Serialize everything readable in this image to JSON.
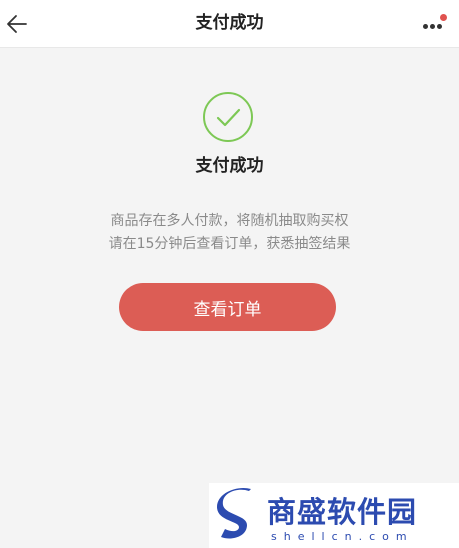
{
  "header": {
    "title": "支付成功",
    "back_icon": "arrow-left-icon",
    "more_icon": "more-dots-icon",
    "badge_color": "#e0524f"
  },
  "status": {
    "icon": "check-circle-icon",
    "icon_color": "#7dc855",
    "title": "支付成功"
  },
  "message": {
    "line1": "商品存在多人付款，将随机抽取购买权",
    "line2": "请在15分钟后查看订单，获悉抽签结果"
  },
  "actions": {
    "view_order_label": "查看订单",
    "button_color": "#dc5d55"
  },
  "watermark": {
    "name": "商盛软件园",
    "domain": "shellcn.com",
    "color": "#2c4bb0"
  }
}
